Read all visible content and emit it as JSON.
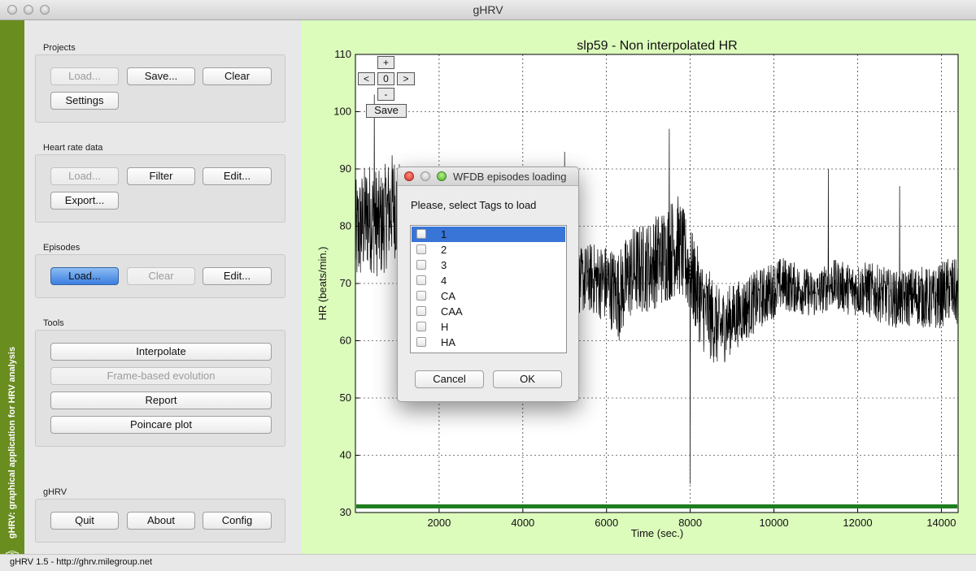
{
  "window": {
    "title": "gHRV"
  },
  "sidebar": {
    "vertical_text": "gHRV: graphical application for HRV analysis"
  },
  "groups": {
    "projects": {
      "label": "Projects",
      "load": "Load...",
      "save": "Save...",
      "clear": "Clear",
      "settings": "Settings"
    },
    "heart_rate": {
      "label": "Heart rate data",
      "load": "Load...",
      "filter": "Filter",
      "edit": "Edit...",
      "export": "Export..."
    },
    "episodes": {
      "label": "Episodes",
      "load": "Load...",
      "clear": "Clear",
      "edit": "Edit..."
    },
    "tools": {
      "label": "Tools",
      "interpolate": "Interpolate",
      "frame_based": "Frame-based evolution",
      "report": "Report",
      "poincare": "Poincare plot"
    },
    "ghrv": {
      "label": "gHRV",
      "quit": "Quit",
      "about": "About",
      "config": "Config"
    }
  },
  "status": {
    "text": "gHRV 1.5 - http://ghrv.milegroup.net"
  },
  "plot_nav": {
    "plus": "+",
    "left": "<",
    "value": "0",
    "right": ">",
    "minus": "-",
    "save": "Save"
  },
  "chart_data": {
    "type": "line",
    "title": "slp59 - Non interpolated HR",
    "xlabel": "Time (sec.)",
    "ylabel": "HR (beats/min.)",
    "xlim": [
      0,
      14400
    ],
    "ylim": [
      30,
      110
    ],
    "x_ticks": [
      2000,
      4000,
      6000,
      8000,
      10000,
      12000,
      14000
    ],
    "y_ticks": [
      30,
      40,
      50,
      60,
      70,
      80,
      90,
      100,
      110
    ],
    "grid": true,
    "series": [
      {
        "color": "#000000",
        "points": [
          [
            0,
            78
          ],
          [
            300,
            82
          ],
          [
            600,
            80
          ],
          [
            900,
            84
          ],
          [
            1200,
            80
          ],
          [
            1500,
            83
          ],
          [
            1800,
            79
          ],
          [
            2100,
            78
          ],
          [
            2400,
            76
          ],
          [
            2700,
            75
          ],
          [
            3000,
            74
          ],
          [
            3300,
            73
          ],
          [
            3600,
            72
          ],
          [
            4000,
            71
          ],
          [
            4400,
            72
          ],
          [
            4800,
            71
          ],
          [
            5200,
            70
          ],
          [
            5600,
            71
          ],
          [
            6000,
            70
          ],
          [
            6300,
            68
          ],
          [
            6600,
            72
          ],
          [
            7000,
            73
          ],
          [
            7400,
            75
          ],
          [
            7700,
            77
          ],
          [
            8000,
            72
          ],
          [
            8300,
            66
          ],
          [
            8700,
            62
          ],
          [
            9000,
            64
          ],
          [
            9400,
            66
          ],
          [
            9800,
            68
          ],
          [
            10200,
            70
          ],
          [
            10600,
            69
          ],
          [
            11000,
            68
          ],
          [
            11400,
            70
          ],
          [
            11800,
            69
          ],
          [
            12200,
            69
          ],
          [
            12600,
            68
          ],
          [
            13000,
            67
          ],
          [
            13400,
            68
          ],
          [
            13800,
            67
          ],
          [
            14200,
            69
          ],
          [
            14400,
            68
          ]
        ],
        "variability": [
          [
            0,
            10
          ],
          [
            1200,
            9
          ],
          [
            2400,
            6
          ],
          [
            3600,
            5
          ],
          [
            5000,
            5
          ],
          [
            6000,
            7
          ],
          [
            6300,
            8
          ],
          [
            7000,
            8
          ],
          [
            7600,
            9
          ],
          [
            8000,
            8
          ],
          [
            8400,
            8
          ],
          [
            9000,
            6
          ],
          [
            10000,
            5
          ],
          [
            11000,
            4
          ],
          [
            12400,
            5
          ],
          [
            13000,
            5
          ],
          [
            14400,
            6
          ]
        ],
        "peaks": [
          [
            450,
            103
          ],
          [
            5000,
            93
          ],
          [
            7500,
            97
          ],
          [
            8000,
            35
          ],
          [
            11300,
            90
          ],
          [
            13000,
            87
          ]
        ]
      }
    ],
    "episode_bar": {
      "y": 31,
      "color": "#1e7d1e"
    }
  },
  "dialog": {
    "title": "WFDB episodes loading",
    "prompt": "Please, select Tags to load",
    "tags": [
      "1",
      "2",
      "3",
      "4",
      "CA",
      "CAA",
      "H",
      "HA"
    ],
    "selected_index": 0,
    "cancel": "Cancel",
    "ok": "OK"
  }
}
